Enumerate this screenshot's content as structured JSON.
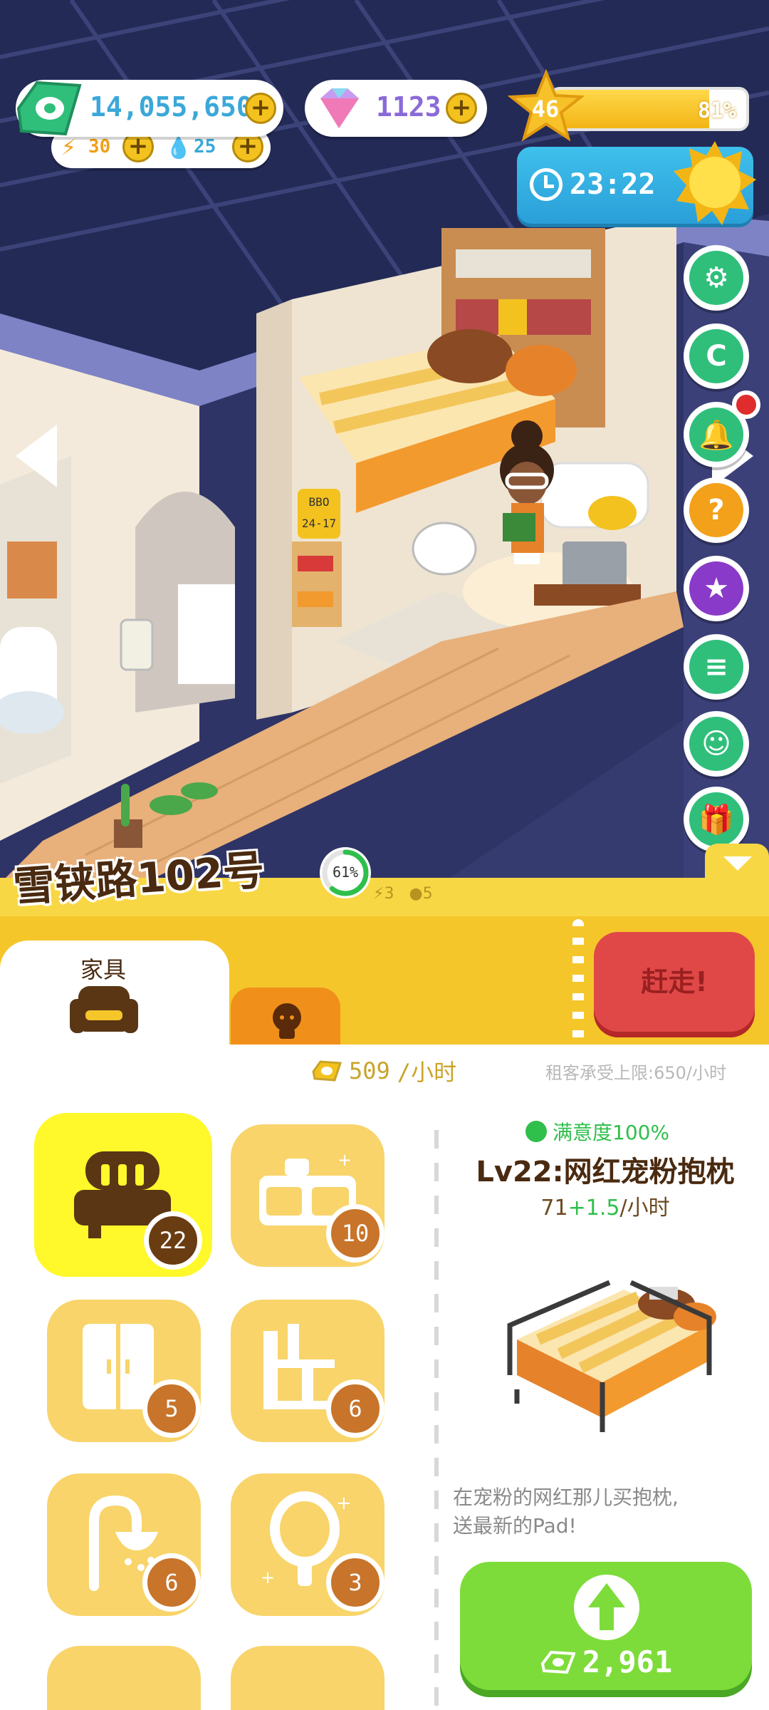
{
  "hud": {
    "money": "14,055,650",
    "energy": "30",
    "water": "25",
    "gems": "1123",
    "level": "46",
    "xp_percent_label": "81%",
    "xp_fraction": 0.81,
    "timer": "23:22",
    "icons": {
      "money": "cash-icon",
      "energy": "lightning-icon",
      "water": "water-drop-icon",
      "gem": "diamond-icon",
      "level": "star-icon",
      "timer": "clock-icon",
      "weather": "sun-icon"
    }
  },
  "side_buttons": [
    "gear-icon",
    "c-coin-icon",
    "bell-icon",
    "mystery-box-icon",
    "star-book-icon",
    "notes-icon",
    "chat-icon",
    "gift-icon"
  ],
  "scene": {
    "plate_top": "BBO",
    "plate_bottom": "24-17"
  },
  "address": {
    "title": "雪铗路102号",
    "occupancy_label": "61%",
    "occupancy_fraction": 0.61,
    "energy_cost": "3",
    "coin_cost": "5"
  },
  "tabs": {
    "furniture_label": "家具",
    "evict_label": "赶走!"
  },
  "income": {
    "value": "509",
    "unit": "/小时",
    "rent_limit": "租客承受上限:650/小时"
  },
  "categories": [
    {
      "name": "bed",
      "count": "22",
      "active": true
    },
    {
      "name": "cabinet",
      "count": "10"
    },
    {
      "name": "wardrobe",
      "count": "5"
    },
    {
      "name": "shelf",
      "count": "6"
    },
    {
      "name": "shower",
      "count": "6"
    },
    {
      "name": "mirror",
      "count": "3"
    }
  ],
  "item": {
    "satisfaction": "满意度100%",
    "title": "Lv22:网红宠粉抱枕",
    "rate_base": "71",
    "rate_bonus": "+1.5",
    "rate_unit": "/小时",
    "description_line1": "在宠粉的网红那儿买抱枕,",
    "description_line2": "送最新的Pad!",
    "upgrade_cost": "2,961"
  },
  "colors": {
    "panel_yellow": "#f5c62a",
    "active_category": "#fff82a",
    "evict_red": "#e04848",
    "upgrade_green": "#7edc3a",
    "hud_blue": "#3aa8d8"
  }
}
